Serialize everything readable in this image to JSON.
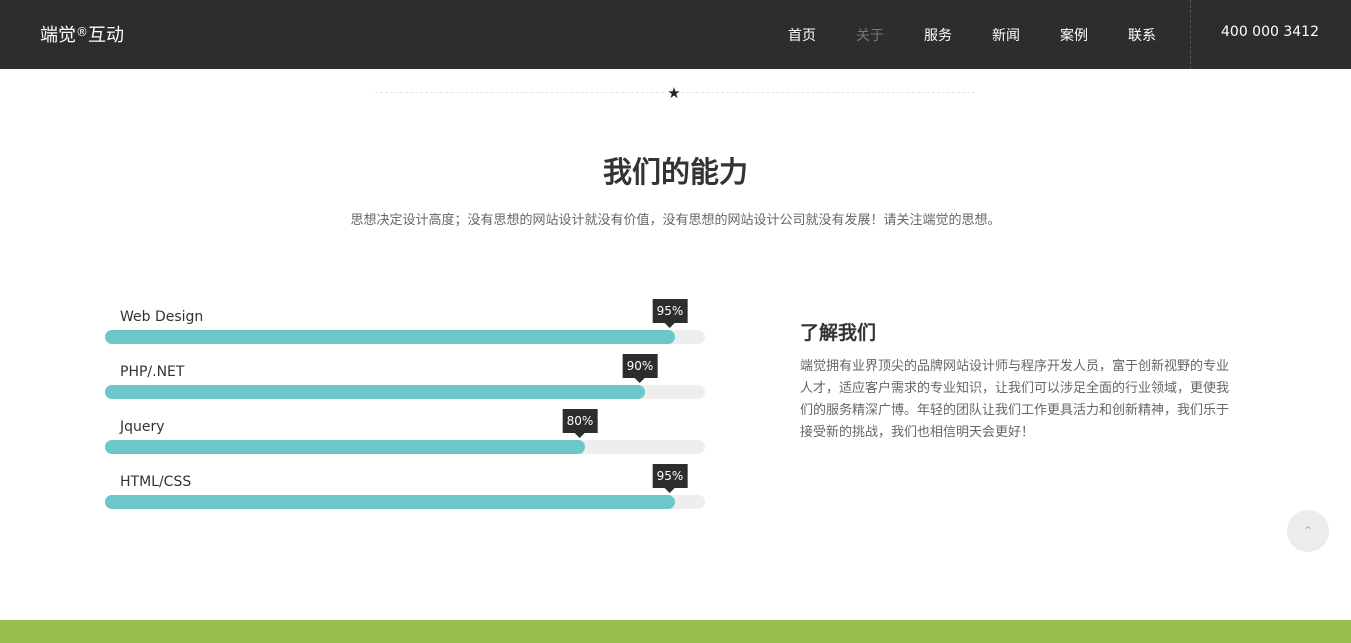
{
  "header": {
    "brand_name": "端觉",
    "brand_mark": "®",
    "brand_suffix": "互动",
    "nav": [
      {
        "label": "首页",
        "active": false
      },
      {
        "label": "关于",
        "active": true
      },
      {
        "label": "服务",
        "active": false
      },
      {
        "label": "新闻",
        "active": false
      },
      {
        "label": "案例",
        "active": false
      },
      {
        "label": "联系",
        "active": false
      }
    ],
    "phone": "400 000 3412"
  },
  "section": {
    "star_icon": "star-icon",
    "title": "我们的能力",
    "subtitle": "思想决定设计高度；没有思想的网站设计就没有价值，没有思想的网站设计公司就没有发展！请关注端觉的思想。"
  },
  "skills": [
    {
      "name": "Web Design",
      "label": "95%",
      "percent": 95
    },
    {
      "name": "PHP/.NET",
      "label": "90%",
      "percent": 90
    },
    {
      "name": "Jquery",
      "label": "80%",
      "percent": 80
    },
    {
      "name": "HTML/CSS",
      "label": "95%",
      "percent": 95
    }
  ],
  "about": {
    "title": "了解我们",
    "text": "端觉拥有业界顶尖的品牌网站设计师与程序开发人员，富于创新视野的专业人才，适应客户需求的专业知识，让我们可以涉足全面的行业领域，更使我们的服务精深广博。年轻的团队让我们工作更具活力和创新精神，我们乐于接受新的挑战，我们也相信明天会更好！"
  },
  "back_to_top": {
    "icon": "chevron-up-icon",
    "glyph": "⌃"
  },
  "colors": {
    "header_bg": "#2d2d2d",
    "bar_fill": "#6cc8c8",
    "bar_track": "#eeeeee",
    "tooltip_bg": "#2d2d2d",
    "footer_band": "#95bf4a"
  }
}
